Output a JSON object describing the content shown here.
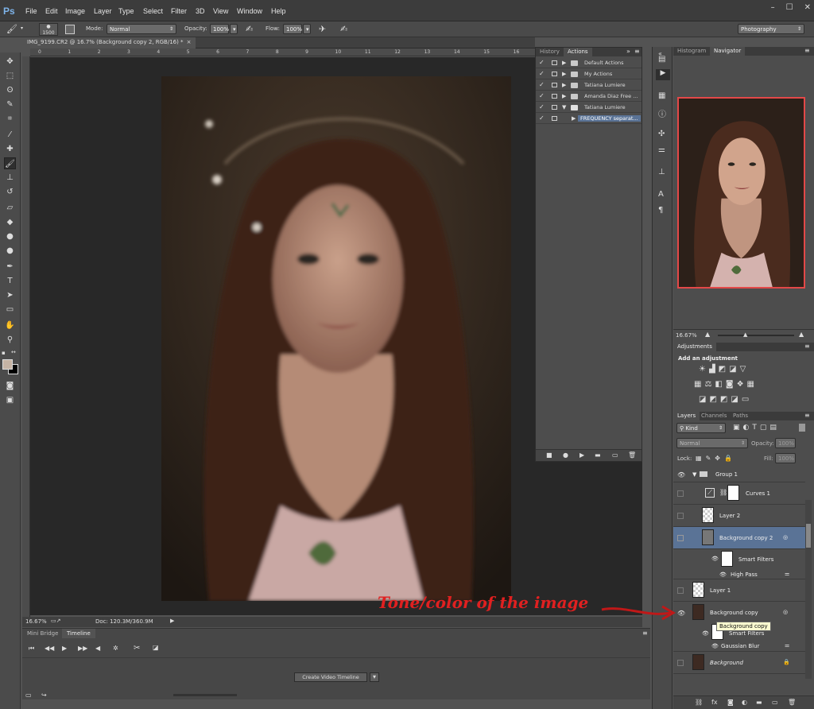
{
  "app": {
    "logo": "Ps",
    "menus": [
      "File",
      "Edit",
      "Image",
      "Layer",
      "Type",
      "Select",
      "Filter",
      "3D",
      "View",
      "Window",
      "Help"
    ]
  },
  "options": {
    "brush_size": "1500",
    "mode_label": "Mode:",
    "mode_value": "Normal",
    "opacity_label": "Opacity:",
    "opacity_value": "100%",
    "flow_label": "Flow:",
    "flow_value": "100%",
    "workspace": "Photography"
  },
  "document": {
    "tab_title": "IMG_9199.CR2 @ 16.7% (Background copy 2, RGB/16) *",
    "ruler_ticks": [
      "0",
      "1",
      "2",
      "3",
      "4",
      "5",
      "6",
      "7",
      "8",
      "9",
      "10",
      "11",
      "12",
      "13",
      "14",
      "15",
      "16"
    ],
    "zoom": "16.67%",
    "doc_info": "Doc: 120.3M/360.9M"
  },
  "timeline": {
    "tabs": [
      "Mini Bridge",
      "Timeline"
    ],
    "create_button": "Create Video Timeline"
  },
  "actions_panel": {
    "tabs": [
      "History",
      "Actions"
    ],
    "rows": [
      {
        "label": "Default Actions",
        "type": "set"
      },
      {
        "label": "My Actions",
        "type": "set"
      },
      {
        "label": "Tatiana Lumiere",
        "type": "set"
      },
      {
        "label": "Amanda Diaz Free ...",
        "type": "set"
      },
      {
        "label": "Tatiana Lumiere",
        "type": "set-open"
      },
      {
        "label": "FREQUENCY separat...",
        "type": "action-selected"
      }
    ]
  },
  "navigator": {
    "tabs": [
      "Histogram",
      "Navigator"
    ],
    "zoom": "16.67%"
  },
  "adjustments": {
    "tab": "Adjustments",
    "heading": "Add an adjustment"
  },
  "layers_panel": {
    "tabs": [
      "Layers",
      "Channels",
      "Paths"
    ],
    "filter_kind": "Kind",
    "blend_mode": "Normal",
    "opacity_label": "Opacity:",
    "opacity_value": "100%",
    "lock_label": "Lock:",
    "fill_label": "Fill:",
    "fill_value": "100%",
    "layers": [
      "Group 1",
      "Curves 1",
      "Layer 2",
      "Background copy 2",
      "Smart Filters",
      "High Pass",
      "Layer 1",
      "Background copy",
      "Smart Filters",
      "Gaussian Blur",
      "Background"
    ]
  },
  "annotation": {
    "text": "Tone/color of the image",
    "tooltip": "Background copy"
  },
  "colors": {
    "annotation": "#e02020",
    "selection": "#5a7396",
    "nav_border": "#e34848"
  }
}
